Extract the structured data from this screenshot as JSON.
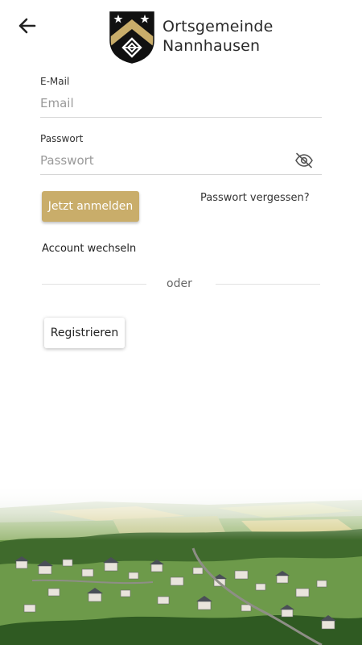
{
  "header": {
    "back_icon": "arrow-left-icon",
    "logo_icon": "coat-of-arms-icon",
    "org_line1": "Ortsgemeinde",
    "org_line2": "Nannhausen"
  },
  "login_form": {
    "email_label": "E-Mail",
    "email_placeholder": "Email",
    "password_label": "Passwort",
    "password_placeholder": "Passwort",
    "password_toggle_icon": "eye-off-icon",
    "login_button": "Jetzt anmelden",
    "forgot_password": "Passwort vergessen?",
    "switch_account": "Account wechseln",
    "divider_text": "oder",
    "register_button": "Registrieren"
  },
  "colors": {
    "accent_gold": "#c9ad6a",
    "crest_black": "#111111"
  },
  "background_image": "village-aerial-landscape"
}
